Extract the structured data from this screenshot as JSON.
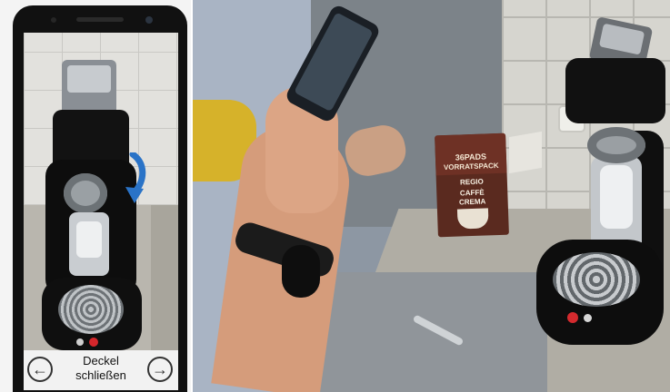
{
  "app_screen": {
    "instruction": {
      "line1": "Deckel",
      "line2": "schließen"
    },
    "nav": {
      "previous_icon": "arrow-left-circle-icon",
      "next_icon": "arrow-right-circle-icon",
      "previous_glyph": "←",
      "next_glyph": "→"
    },
    "ar_overlay": {
      "icon": "curved-arrow-down-icon",
      "color": "#2a73c7"
    }
  },
  "scene": {
    "coffee_pack": {
      "line1": "36PADS",
      "line2": "VORRATSPACK",
      "brand": "REGIO",
      "label1": "CAFFÈ",
      "label2": "CREMA"
    }
  }
}
